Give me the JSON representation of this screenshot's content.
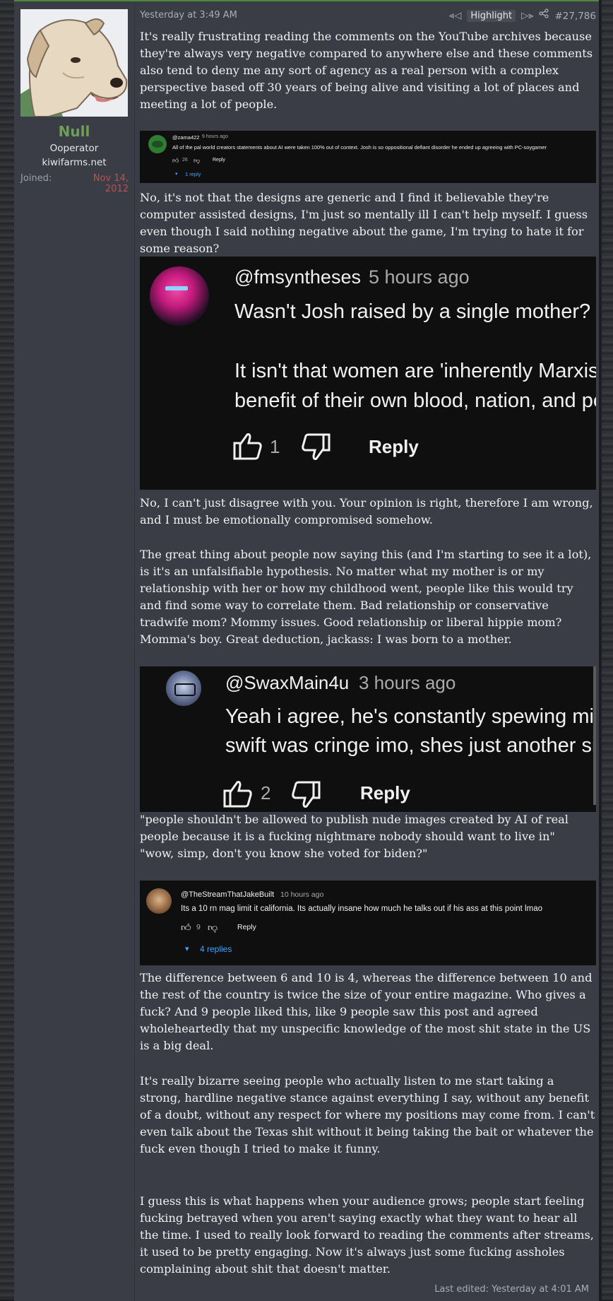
{
  "user": {
    "name": "Null",
    "title": "Ooperator",
    "site": "kiwifarms.net",
    "joined_label": "Joined:",
    "joined_date": "Nov 14, 2012"
  },
  "meta": {
    "timestamp": "Yesterday at 3:49 AM",
    "highlight_label": "Highlight",
    "post_number": "#27,786"
  },
  "paragraphs": [
    "It's really frustrating reading the comments on the YouTube archives because they're always very negative compared to anywhere else and these comments also tend to deny me any sort of agency as a real person with a complex perspective based off 30 years of being alive and visiting a lot of places and meeting a lot of people.",
    "No, it's not that the designs are generic and I find it believable they're computer assisted designs, I'm just so mentally ill I can't help myself. I guess even though I said nothing negative about the game, I'm trying to hate it for some reason?",
    "No, I can't just disagree with you. Your opinion is right, therefore I am wrong, and I must be emotionally compromised somehow.",
    "The great thing about people now saying this (and I'm starting to see it a lot), is it's an unfalsifiable hypothesis. No matter what my mother is or my relationship with her or how my childhood went, people like this would try and find some way to correlate them. Bad relationship or conservative tradwife mom? Mommy issues. Good relationship or liberal hippie mom? Momma's boy. Great deduction, jackass: I was born to a mother.",
    "\"people shouldn't be allowed to publish nude images created by AI of real people because it is a fucking nightmare nobody should want to live in\"\n\"wow, simp, don't you know she voted for biden?\"",
    "The difference between 6 and 10 is 4, whereas the difference between 10 and the rest of the country is twice the size of your entire magazine. Who gives a fuck? And 9 people liked this, like 9 people saw this post and agreed wholeheartedly that my unspecific knowledge of the most shit state in the US is a big deal.",
    "It's really bizarre seeing people who actually listen to me start taking a strong, hardline negative stance against everything I say, without any benefit of a doubt, without any respect for where my positions may come from. I can't even talk about the Texas shit without it being taking the bait or whatever the fuck even though I tried to make it funny.",
    "I guess this is what happens when your audience grows; people start feeling fucking betrayed when you aren't saying exactly what they want to hear all the time. I used to really look forward to reading the comments after streams, it used to be pretty engaging. Now it's always just some fucking assholes complaining about shit that doesn't matter."
  ],
  "comments": [
    {
      "author": "@zama422",
      "age": "9 hours ago",
      "text": "All of the pal world creators statements about AI were taken 100% out of context. Josh is so oppositional defiant disorder he ended up agreeing with PC-soygamer",
      "likes": "26",
      "reply_label": "Reply",
      "replies": "1 reply"
    },
    {
      "author": "@fmsyntheses",
      "age": "5 hours ago",
      "line1": "Wasn't Josh raised by a single mother?",
      "line2": "It isn't that women are 'inherently Marxist', they just don't act for the",
      "line3": "benefit of their own blood, nation, and people.",
      "likes": "1",
      "reply_label": "Reply"
    },
    {
      "author": "@SwaxMain4u",
      "age": "3 hours ago",
      "line1": "Yeah i agree, he's constantly spewing misinformation. His take on taylor",
      "line2": "swift was cringe imo, shes just another silly celebrity.",
      "likes": "2",
      "reply_label": "Reply"
    },
    {
      "author": "@TheStreamThatJakeBuilt",
      "age": "10 hours ago",
      "text": "Its a 10 rn mag limit it california. Its actually insane how much he talks out if his ass at this point lmao",
      "likes": "9",
      "reply_label": "Reply",
      "replies": "4 replies"
    }
  ],
  "footer": {
    "last_edited": "Last edited: Yesterday at 4:01 AM"
  },
  "colors": {
    "accent_username": "#6f9f55",
    "joined_date": "#c0504d",
    "post_bg": "#3a3d45",
    "youtube_bg": "#0f0f0f",
    "youtube_link": "#3ea6ff"
  },
  "icons": [
    "previous-highlight-icon",
    "next-highlight-icon",
    "share-icon",
    "like-icon",
    "dislike-icon",
    "chevron-down-icon"
  ]
}
